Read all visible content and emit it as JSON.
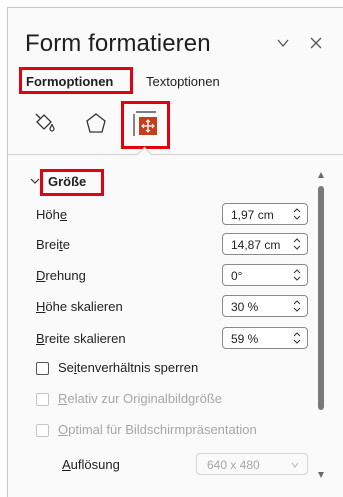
{
  "pane": {
    "title": "Form formatieren"
  },
  "tabs": [
    {
      "label": "Formoptionen",
      "active": true
    },
    {
      "label": "Textoptionen",
      "active": false
    }
  ],
  "icon_tabs": [
    {
      "name": "fill-line-icon"
    },
    {
      "name": "effects-icon"
    },
    {
      "name": "size-properties-icon",
      "active": true
    }
  ],
  "section": {
    "title": "Größe",
    "fields": [
      {
        "label_pre": "Höh",
        "label_ul": "e",
        "label_post": "",
        "value": "1,97 cm"
      },
      {
        "label_pre": "Brei",
        "label_ul": "t",
        "label_post": "e",
        "value": "14,87 cm"
      },
      {
        "label_pre": "",
        "label_ul": "D",
        "label_post": "rehung",
        "value": "0°"
      },
      {
        "label_pre": "",
        "label_ul": "H",
        "label_post": "öhe skalieren",
        "value": "30 %"
      },
      {
        "label_pre": "",
        "label_ul": "B",
        "label_post": "reite skalieren",
        "value": "59 %"
      }
    ],
    "checkboxes": [
      {
        "label_pre": "Se",
        "label_ul": "i",
        "label_post": "tenverhältnis sperren",
        "checked": false,
        "disabled": false
      },
      {
        "label_pre": "",
        "label_ul": "R",
        "label_post": "elativ zur Originalbildgröße",
        "checked": false,
        "disabled": true
      },
      {
        "label_pre": "",
        "label_ul": "O",
        "label_post": "ptimal für Bildschirmpräsentation",
        "checked": false,
        "disabled": true
      }
    ],
    "resolution": {
      "label_pre": "",
      "label_ul": "A",
      "label_post": "uflösung",
      "value": "640 x 480"
    }
  },
  "colors": {
    "highlight": "#e3000f",
    "active_icon": "#c43e1c"
  }
}
